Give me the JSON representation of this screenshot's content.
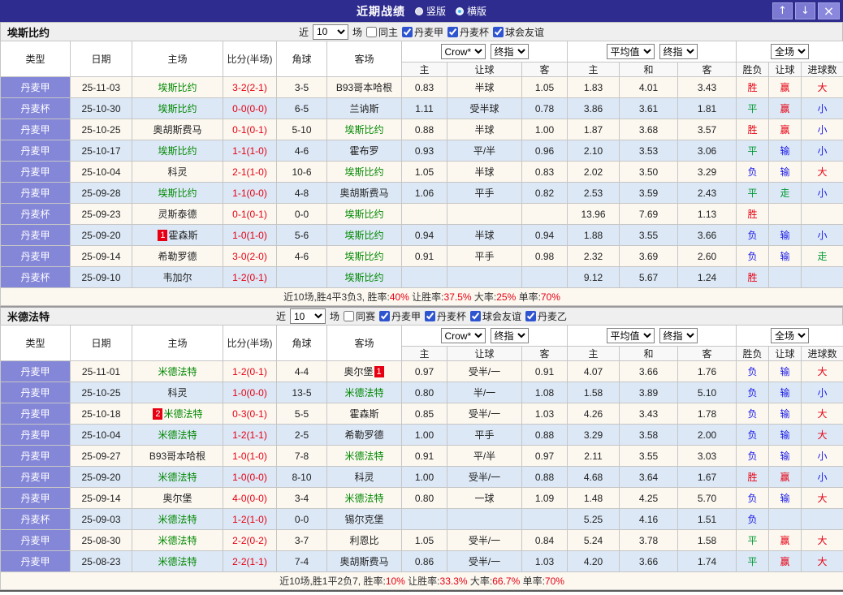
{
  "titlebar": {
    "title": "近期战绩",
    "radios": [
      {
        "label": "竖版",
        "selected": false
      },
      {
        "label": "横版",
        "selected": true
      }
    ],
    "buttons": {
      "up": "↑",
      "down": "↓",
      "close": "×"
    }
  },
  "table_header": {
    "static_cols": [
      "类型",
      "日期",
      "主场",
      "比分(半场)",
      "角球",
      "客场"
    ],
    "odds1_selects": [
      "Crow*",
      "终指"
    ],
    "odds1_cols": [
      "主",
      "让球",
      "客"
    ],
    "odds2_selects": [
      "平均值",
      "终指"
    ],
    "odds2_cols": [
      "主",
      "和",
      "客"
    ],
    "result_select": "全场",
    "result_cols": [
      "胜负",
      "让球",
      "进球数"
    ]
  },
  "colors": {
    "titlebar_bg": "#2e2c8e",
    "button_bg": "#7b79d2",
    "league_cell_bg": "#8486d8",
    "row_bg": "#fcf8f0",
    "row_alt_bg": "#dce8f6",
    "win_red": "#e60012",
    "draw_green": "#009933",
    "loss_blue": "#1a1ae6",
    "team_green": "#008800"
  },
  "sections": [
    {
      "team": "埃斯比约",
      "filter": {
        "near": "近",
        "count": "10",
        "games": "场",
        "checks": [
          {
            "label": "同主",
            "checked": false
          },
          {
            "label": "丹麦甲",
            "checked": true
          },
          {
            "label": "丹麦杯",
            "checked": true
          },
          {
            "label": "球会友谊",
            "checked": true
          }
        ]
      },
      "rows": [
        {
          "type": "丹麦甲",
          "date": "25-11-03",
          "home": {
            "text": "埃斯比约",
            "hl": true
          },
          "score": "3-2(2-1)",
          "corners": "3-5",
          "away": {
            "text": "B93哥本哈根",
            "hl": false
          },
          "odds": [
            "0.83",
            "半球",
            "1.05"
          ],
          "avg": [
            "1.83",
            "4.01",
            "3.43"
          ],
          "res": [
            {
              "t": "胜",
              "c": "r"
            },
            {
              "t": "赢",
              "c": "r"
            },
            {
              "t": "大",
              "c": "r"
            }
          ]
        },
        {
          "type": "丹麦杯",
          "date": "25-10-30",
          "home": {
            "text": "埃斯比约",
            "hl": true
          },
          "score": "0-0(0-0)",
          "corners": "6-5",
          "away": {
            "text": "兰讷斯",
            "hl": false
          },
          "odds": [
            "1.11",
            "受半球",
            "0.78"
          ],
          "avg": [
            "3.86",
            "3.61",
            "1.81"
          ],
          "res": [
            {
              "t": "平",
              "c": "g"
            },
            {
              "t": "赢",
              "c": "r"
            },
            {
              "t": "小",
              "c": "b"
            }
          ]
        },
        {
          "type": "丹麦甲",
          "date": "25-10-25",
          "home": {
            "text": "奥胡斯费马",
            "hl": false
          },
          "score": "0-1(0-1)",
          "corners": "5-10",
          "away": {
            "text": "埃斯比约",
            "hl": true
          },
          "odds": [
            "0.88",
            "半球",
            "1.00"
          ],
          "avg": [
            "1.87",
            "3.68",
            "3.57"
          ],
          "res": [
            {
              "t": "胜",
              "c": "r"
            },
            {
              "t": "赢",
              "c": "r"
            },
            {
              "t": "小",
              "c": "b"
            }
          ]
        },
        {
          "type": "丹麦甲",
          "date": "25-10-17",
          "home": {
            "text": "埃斯比约",
            "hl": true
          },
          "score": "1-1(1-0)",
          "corners": "4-6",
          "away": {
            "text": "霍布罗",
            "hl": false
          },
          "odds": [
            "0.93",
            "平/半",
            "0.96"
          ],
          "avg": [
            "2.10",
            "3.53",
            "3.06"
          ],
          "res": [
            {
              "t": "平",
              "c": "g"
            },
            {
              "t": "输",
              "c": "b"
            },
            {
              "t": "小",
              "c": "b"
            }
          ]
        },
        {
          "type": "丹麦甲",
          "date": "25-10-04",
          "home": {
            "text": "科灵",
            "hl": false
          },
          "score": "2-1(1-0)",
          "corners": "10-6",
          "away": {
            "text": "埃斯比约",
            "hl": true
          },
          "odds": [
            "1.05",
            "半球",
            "0.83"
          ],
          "avg": [
            "2.02",
            "3.50",
            "3.29"
          ],
          "res": [
            {
              "t": "负",
              "c": "b"
            },
            {
              "t": "输",
              "c": "b"
            },
            {
              "t": "大",
              "c": "r"
            }
          ]
        },
        {
          "type": "丹麦甲",
          "date": "25-09-28",
          "home": {
            "text": "埃斯比约",
            "hl": true
          },
          "score": "1-1(0-0)",
          "corners": "4-8",
          "away": {
            "text": "奥胡斯费马",
            "hl": false
          },
          "odds": [
            "1.06",
            "平手",
            "0.82"
          ],
          "avg": [
            "2.53",
            "3.59",
            "2.43"
          ],
          "res": [
            {
              "t": "平",
              "c": "g"
            },
            {
              "t": "走",
              "c": "g"
            },
            {
              "t": "小",
              "c": "b"
            }
          ]
        },
        {
          "type": "丹麦杯",
          "date": "25-09-23",
          "home": {
            "text": "灵斯泰德",
            "hl": false
          },
          "score": "0-1(0-1)",
          "corners": "0-0",
          "away": {
            "text": "埃斯比约",
            "hl": true
          },
          "odds": [
            "",
            "",
            ""
          ],
          "avg": [
            "13.96",
            "7.69",
            "1.13"
          ],
          "res": [
            {
              "t": "胜",
              "c": "r"
            },
            {
              "t": "",
              "c": "d"
            },
            {
              "t": "",
              "c": "d"
            }
          ]
        },
        {
          "type": "丹麦甲",
          "date": "25-09-20",
          "home": {
            "text": "霍森斯",
            "hl": false,
            "badge": "1",
            "badge_pos": "before"
          },
          "score": "1-0(1-0)",
          "corners": "5-6",
          "away": {
            "text": "埃斯比约",
            "hl": true
          },
          "odds": [
            "0.94",
            "半球",
            "0.94"
          ],
          "avg": [
            "1.88",
            "3.55",
            "3.66"
          ],
          "res": [
            {
              "t": "负",
              "c": "b"
            },
            {
              "t": "输",
              "c": "b"
            },
            {
              "t": "小",
              "c": "b"
            }
          ]
        },
        {
          "type": "丹麦甲",
          "date": "25-09-14",
          "home": {
            "text": "希勒罗德",
            "hl": false
          },
          "score": "3-0(2-0)",
          "corners": "4-6",
          "away": {
            "text": "埃斯比约",
            "hl": true
          },
          "odds": [
            "0.91",
            "平手",
            "0.98"
          ],
          "avg": [
            "2.32",
            "3.69",
            "2.60"
          ],
          "res": [
            {
              "t": "负",
              "c": "b"
            },
            {
              "t": "输",
              "c": "b"
            },
            {
              "t": "走",
              "c": "g"
            }
          ]
        },
        {
          "type": "丹麦杯",
          "date": "25-09-10",
          "home": {
            "text": "韦加尔",
            "hl": false
          },
          "score": "1-2(0-1)",
          "corners": "",
          "away": {
            "text": "埃斯比约",
            "hl": true
          },
          "odds": [
            "",
            "",
            ""
          ],
          "avg": [
            "9.12",
            "5.67",
            "1.24"
          ],
          "res": [
            {
              "t": "胜",
              "c": "r"
            },
            {
              "t": "",
              "c": "d"
            },
            {
              "t": "",
              "c": "d"
            }
          ]
        }
      ],
      "summary": [
        {
          "t": "近10场,胜4平3负3, 胜率:",
          "c": "d"
        },
        {
          "t": "40%",
          "c": "r"
        },
        {
          "t": " 让胜率:",
          "c": "d"
        },
        {
          "t": "37.5%",
          "c": "r"
        },
        {
          "t": " 大率:",
          "c": "d"
        },
        {
          "t": "25%",
          "c": "r"
        },
        {
          "t": " 单率:",
          "c": "d"
        },
        {
          "t": "70%",
          "c": "r"
        }
      ]
    },
    {
      "team": "米德法特",
      "filter": {
        "near": "近",
        "count": "10",
        "games": "场",
        "checks": [
          {
            "label": "同赛",
            "checked": false
          },
          {
            "label": "丹麦甲",
            "checked": true
          },
          {
            "label": "丹麦杯",
            "checked": true
          },
          {
            "label": "球会友谊",
            "checked": true
          },
          {
            "label": "丹麦乙",
            "checked": true
          }
        ]
      },
      "rows": [
        {
          "type": "丹麦甲",
          "date": "25-11-01",
          "home": {
            "text": "米德法特",
            "hl": true
          },
          "score": "1-2(0-1)",
          "corners": "4-4",
          "away": {
            "text": "奥尔堡",
            "hl": false,
            "badge": "1",
            "badge_pos": "after"
          },
          "odds": [
            "0.97",
            "受半/一",
            "0.91"
          ],
          "avg": [
            "4.07",
            "3.66",
            "1.76"
          ],
          "res": [
            {
              "t": "负",
              "c": "b"
            },
            {
              "t": "输",
              "c": "b"
            },
            {
              "t": "大",
              "c": "r"
            }
          ]
        },
        {
          "type": "丹麦甲",
          "date": "25-10-25",
          "home": {
            "text": "科灵",
            "hl": false
          },
          "score": "1-0(0-0)",
          "corners": "13-5",
          "away": {
            "text": "米德法特",
            "hl": true
          },
          "odds": [
            "0.80",
            "半/一",
            "1.08"
          ],
          "avg": [
            "1.58",
            "3.89",
            "5.10"
          ],
          "res": [
            {
              "t": "负",
              "c": "b"
            },
            {
              "t": "输",
              "c": "b"
            },
            {
              "t": "小",
              "c": "b"
            }
          ]
        },
        {
          "type": "丹麦甲",
          "date": "25-10-18",
          "home": {
            "text": "米德法特",
            "hl": true,
            "badge": "2",
            "badge_pos": "before"
          },
          "score": "0-3(0-1)",
          "corners": "5-5",
          "away": {
            "text": "霍森斯",
            "hl": false
          },
          "odds": [
            "0.85",
            "受半/一",
            "1.03"
          ],
          "avg": [
            "4.26",
            "3.43",
            "1.78"
          ],
          "res": [
            {
              "t": "负",
              "c": "b"
            },
            {
              "t": "输",
              "c": "b"
            },
            {
              "t": "大",
              "c": "r"
            }
          ]
        },
        {
          "type": "丹麦甲",
          "date": "25-10-04",
          "home": {
            "text": "米德法特",
            "hl": true
          },
          "score": "1-2(1-1)",
          "corners": "2-5",
          "away": {
            "text": "希勒罗德",
            "hl": false
          },
          "odds": [
            "1.00",
            "平手",
            "0.88"
          ],
          "avg": [
            "3.29",
            "3.58",
            "2.00"
          ],
          "res": [
            {
              "t": "负",
              "c": "b"
            },
            {
              "t": "输",
              "c": "b"
            },
            {
              "t": "大",
              "c": "r"
            }
          ]
        },
        {
          "type": "丹麦甲",
          "date": "25-09-27",
          "home": {
            "text": "B93哥本哈根",
            "hl": false
          },
          "score": "1-0(1-0)",
          "corners": "7-8",
          "away": {
            "text": "米德法特",
            "hl": true
          },
          "odds": [
            "0.91",
            "平/半",
            "0.97"
          ],
          "avg": [
            "2.11",
            "3.55",
            "3.03"
          ],
          "res": [
            {
              "t": "负",
              "c": "b"
            },
            {
              "t": "输",
              "c": "b"
            },
            {
              "t": "小",
              "c": "b"
            }
          ]
        },
        {
          "type": "丹麦甲",
          "date": "25-09-20",
          "home": {
            "text": "米德法特",
            "hl": true
          },
          "score": "1-0(0-0)",
          "corners": "8-10",
          "away": {
            "text": "科灵",
            "hl": false
          },
          "odds": [
            "1.00",
            "受半/一",
            "0.88"
          ],
          "avg": [
            "4.68",
            "3.64",
            "1.67"
          ],
          "res": [
            {
              "t": "胜",
              "c": "r"
            },
            {
              "t": "赢",
              "c": "r"
            },
            {
              "t": "小",
              "c": "b"
            }
          ]
        },
        {
          "type": "丹麦甲",
          "date": "25-09-14",
          "home": {
            "text": "奥尔堡",
            "hl": false
          },
          "score": "4-0(0-0)",
          "corners": "3-4",
          "away": {
            "text": "米德法特",
            "hl": true
          },
          "odds": [
            "0.80",
            "一球",
            "1.09"
          ],
          "avg": [
            "1.48",
            "4.25",
            "5.70"
          ],
          "res": [
            {
              "t": "负",
              "c": "b"
            },
            {
              "t": "输",
              "c": "b"
            },
            {
              "t": "大",
              "c": "r"
            }
          ]
        },
        {
          "type": "丹麦杯",
          "date": "25-09-03",
          "home": {
            "text": "米德法特",
            "hl": true
          },
          "score": "1-2(1-0)",
          "corners": "0-0",
          "away": {
            "text": "锡尔克堡",
            "hl": false
          },
          "odds": [
            "",
            "",
            ""
          ],
          "avg": [
            "5.25",
            "4.16",
            "1.51"
          ],
          "res": [
            {
              "t": "负",
              "c": "b"
            },
            {
              "t": "",
              "c": "d"
            },
            {
              "t": "",
              "c": "d"
            }
          ]
        },
        {
          "type": "丹麦甲",
          "date": "25-08-30",
          "home": {
            "text": "米德法特",
            "hl": true
          },
          "score": "2-2(0-2)",
          "corners": "3-7",
          "away": {
            "text": "利恩比",
            "hl": false
          },
          "odds": [
            "1.05",
            "受半/一",
            "0.84"
          ],
          "avg": [
            "5.24",
            "3.78",
            "1.58"
          ],
          "res": [
            {
              "t": "平",
              "c": "g"
            },
            {
              "t": "赢",
              "c": "r"
            },
            {
              "t": "大",
              "c": "r"
            }
          ]
        },
        {
          "type": "丹麦甲",
          "date": "25-08-23",
          "home": {
            "text": "米德法特",
            "hl": true
          },
          "score": "2-2(1-1)",
          "corners": "7-4",
          "away": {
            "text": "奥胡斯费马",
            "hl": false
          },
          "odds": [
            "0.86",
            "受半/一",
            "1.03"
          ],
          "avg": [
            "4.20",
            "3.66",
            "1.74"
          ],
          "res": [
            {
              "t": "平",
              "c": "g"
            },
            {
              "t": "赢",
              "c": "r"
            },
            {
              "t": "大",
              "c": "r"
            }
          ]
        }
      ],
      "summary": [
        {
          "t": "近10场,胜1平2负7, 胜率:",
          "c": "d"
        },
        {
          "t": "10%",
          "c": "r"
        },
        {
          "t": " 让胜率:",
          "c": "d"
        },
        {
          "t": "33.3%",
          "c": "r"
        },
        {
          "t": " 大率:",
          "c": "d"
        },
        {
          "t": "66.7%",
          "c": "r"
        },
        {
          "t": " 单率:",
          "c": "d"
        },
        {
          "t": "70%",
          "c": "r"
        }
      ]
    }
  ]
}
